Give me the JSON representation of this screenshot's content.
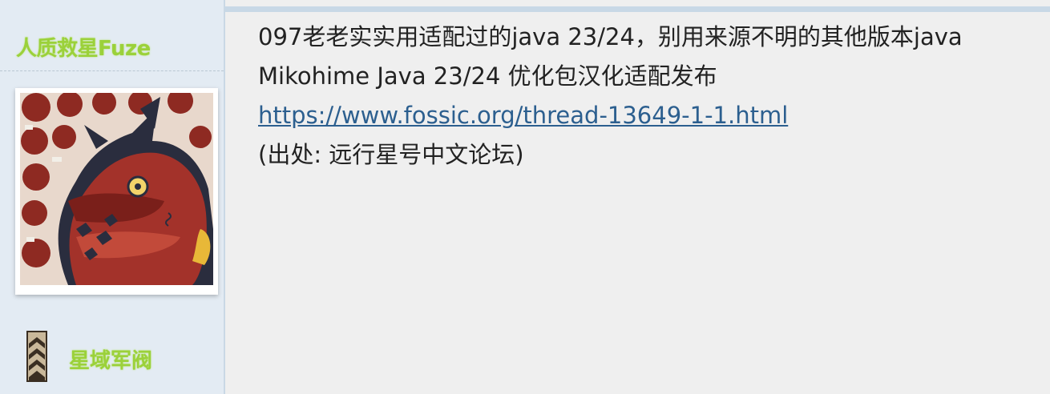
{
  "sidebar": {
    "username": "人质救星Fuze",
    "rank_title": "星域军阀",
    "avatar_icon": "red-dragon-avatar",
    "rank_icon": "rank-chevron-icon"
  },
  "post": {
    "line1": "097老老实实用适配过的java 23/24，别用来源不明的其他版本java",
    "line2": "Mikohime Java 23/24 优化包汉化适配发布",
    "link_text": "https://www.fossic.org/thread-13649-1-1.html",
    "source_note": "(出处: 远行星号中文论坛)"
  },
  "colors": {
    "username_color": "#9bd13a",
    "link_color": "#2c5f8f",
    "sidebar_bg": "#e3ebf3",
    "content_bg": "#efefef"
  }
}
